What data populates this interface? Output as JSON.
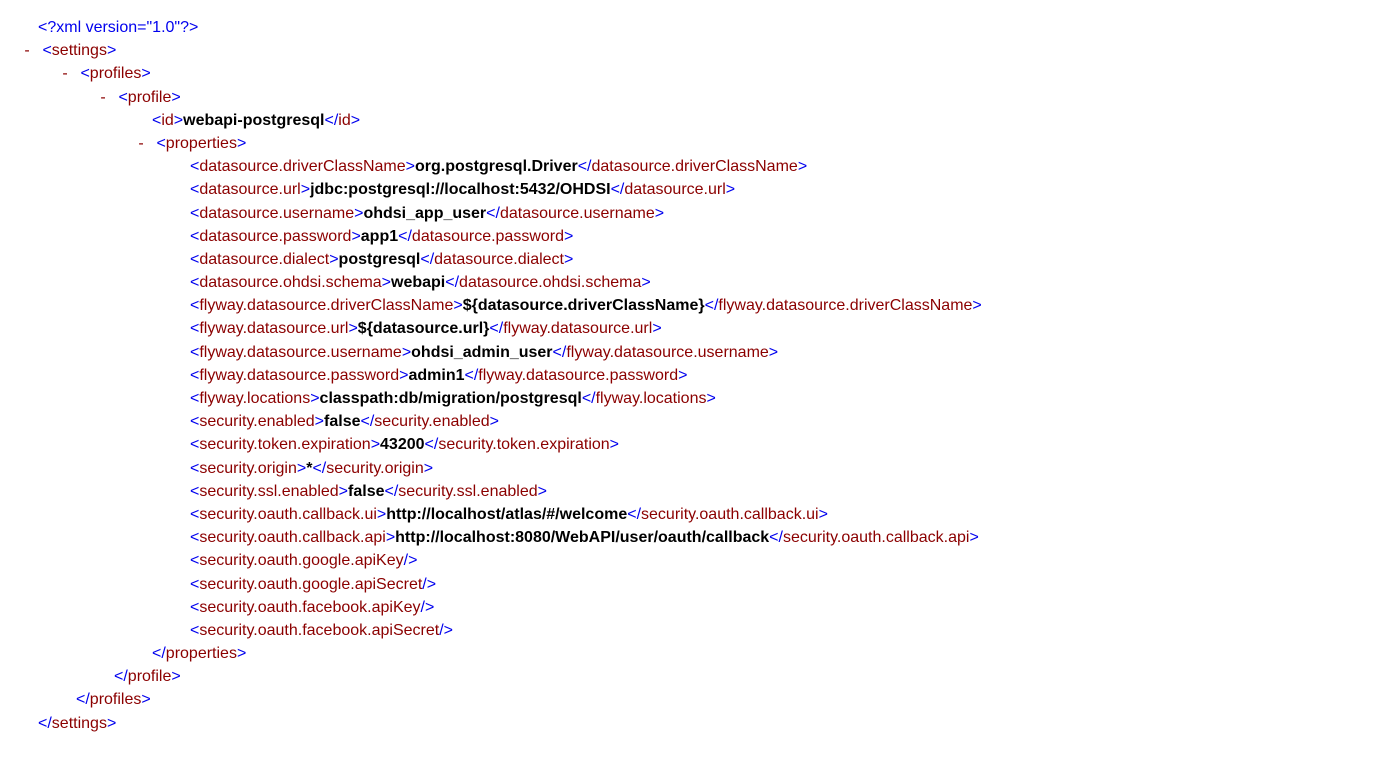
{
  "xmlDecl": "<?xml version=\"1.0\"?>",
  "toggle": "-",
  "settings": {
    "open": "<settings>",
    "close": "</settings>",
    "profiles": {
      "open": "<profiles>",
      "close": "</profiles>",
      "profile": {
        "open": "<profile>",
        "close": "</profile>",
        "id": {
          "open": "<id>",
          "value": "webapi-postgresql",
          "close": "</id>"
        },
        "properties": {
          "open": "<properties>",
          "close": "</properties>",
          "items": [
            {
              "open": "<datasource.driverClassName>",
              "value": "org.postgresql.Driver",
              "close": "</datasource.driverClassName>"
            },
            {
              "open": "<datasource.url>",
              "value": "jdbc:postgresql://localhost:5432/OHDSI",
              "close": "</datasource.url>"
            },
            {
              "open": "<datasource.username>",
              "value": "ohdsi_app_user",
              "close": "</datasource.username>"
            },
            {
              "open": "<datasource.password>",
              "value": "app1",
              "close": "</datasource.password>"
            },
            {
              "open": "<datasource.dialect>",
              "value": "postgresql",
              "close": "</datasource.dialect>"
            },
            {
              "open": "<datasource.ohdsi.schema>",
              "value": "webapi",
              "close": "</datasource.ohdsi.schema>"
            },
            {
              "open": "<flyway.datasource.driverClassName>",
              "value": "${datasource.driverClassName}",
              "close": "</flyway.datasource.driverClassName>"
            },
            {
              "open": "<flyway.datasource.url>",
              "value": "${datasource.url}",
              "close": "</flyway.datasource.url>"
            },
            {
              "open": "<flyway.datasource.username>",
              "value": "ohdsi_admin_user",
              "close": "</flyway.datasource.username>"
            },
            {
              "open": "<flyway.datasource.password>",
              "value": "admin1",
              "close": "</flyway.datasource.password>"
            },
            {
              "open": "<flyway.locations>",
              "value": "classpath:db/migration/postgresql",
              "close": "</flyway.locations>"
            },
            {
              "open": "<security.enabled>",
              "value": "false",
              "close": "</security.enabled>"
            },
            {
              "open": "<security.token.expiration>",
              "value": "43200",
              "close": "</security.token.expiration>"
            },
            {
              "open": "<security.origin>",
              "value": "*",
              "close": "</security.origin>"
            },
            {
              "open": "<security.ssl.enabled>",
              "value": "false",
              "close": "</security.ssl.enabled>"
            },
            {
              "open": "<security.oauth.callback.ui>",
              "value": "http://localhost/atlas/#/welcome",
              "close": "</security.oauth.callback.ui>"
            },
            {
              "open": "<security.oauth.callback.api>",
              "value": "http://localhost:8080/WebAPI/user/oauth/callback",
              "close": "</security.oauth.callback.api>"
            },
            {
              "open": "<security.oauth.google.apiKey/>",
              "value": "",
              "close": ""
            },
            {
              "open": "<security.oauth.google.apiSecret/>",
              "value": "",
              "close": ""
            },
            {
              "open": "<security.oauth.facebook.apiKey/>",
              "value": "",
              "close": ""
            },
            {
              "open": "<security.oauth.facebook.apiSecret/>",
              "value": "",
              "close": ""
            }
          ]
        }
      }
    }
  }
}
